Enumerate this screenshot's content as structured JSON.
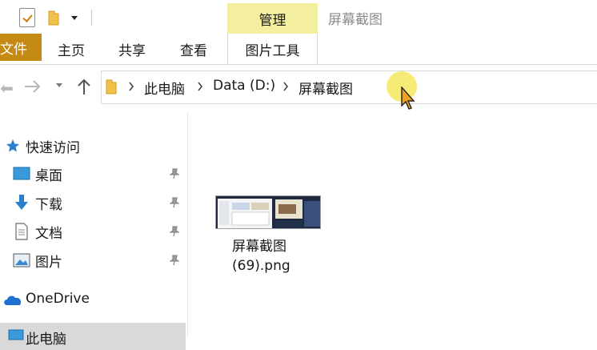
{
  "window": {
    "title": "屏幕截图",
    "context_tab_header": "管理"
  },
  "ribbon": {
    "tabs": [
      "文件",
      "主页",
      "共享",
      "查看",
      "图片工具"
    ]
  },
  "address": {
    "breadcrumbs": [
      "此电脑",
      "Data (D:)",
      "屏幕截图"
    ]
  },
  "nav_pane": {
    "quick_access": "快速访问",
    "pinned": [
      "桌面",
      "下载",
      "文档",
      "图片"
    ],
    "onedrive": "OneDrive",
    "this_pc": "此电脑"
  },
  "files": [
    {
      "name_line1": "屏幕截图",
      "name_line2": "(69).png"
    }
  ],
  "colors": {
    "file_tab": "#c48a13",
    "context_tab": "#f3ef9f",
    "cursor_highlight": "#f6e860",
    "selection": "#d9d9d9"
  }
}
